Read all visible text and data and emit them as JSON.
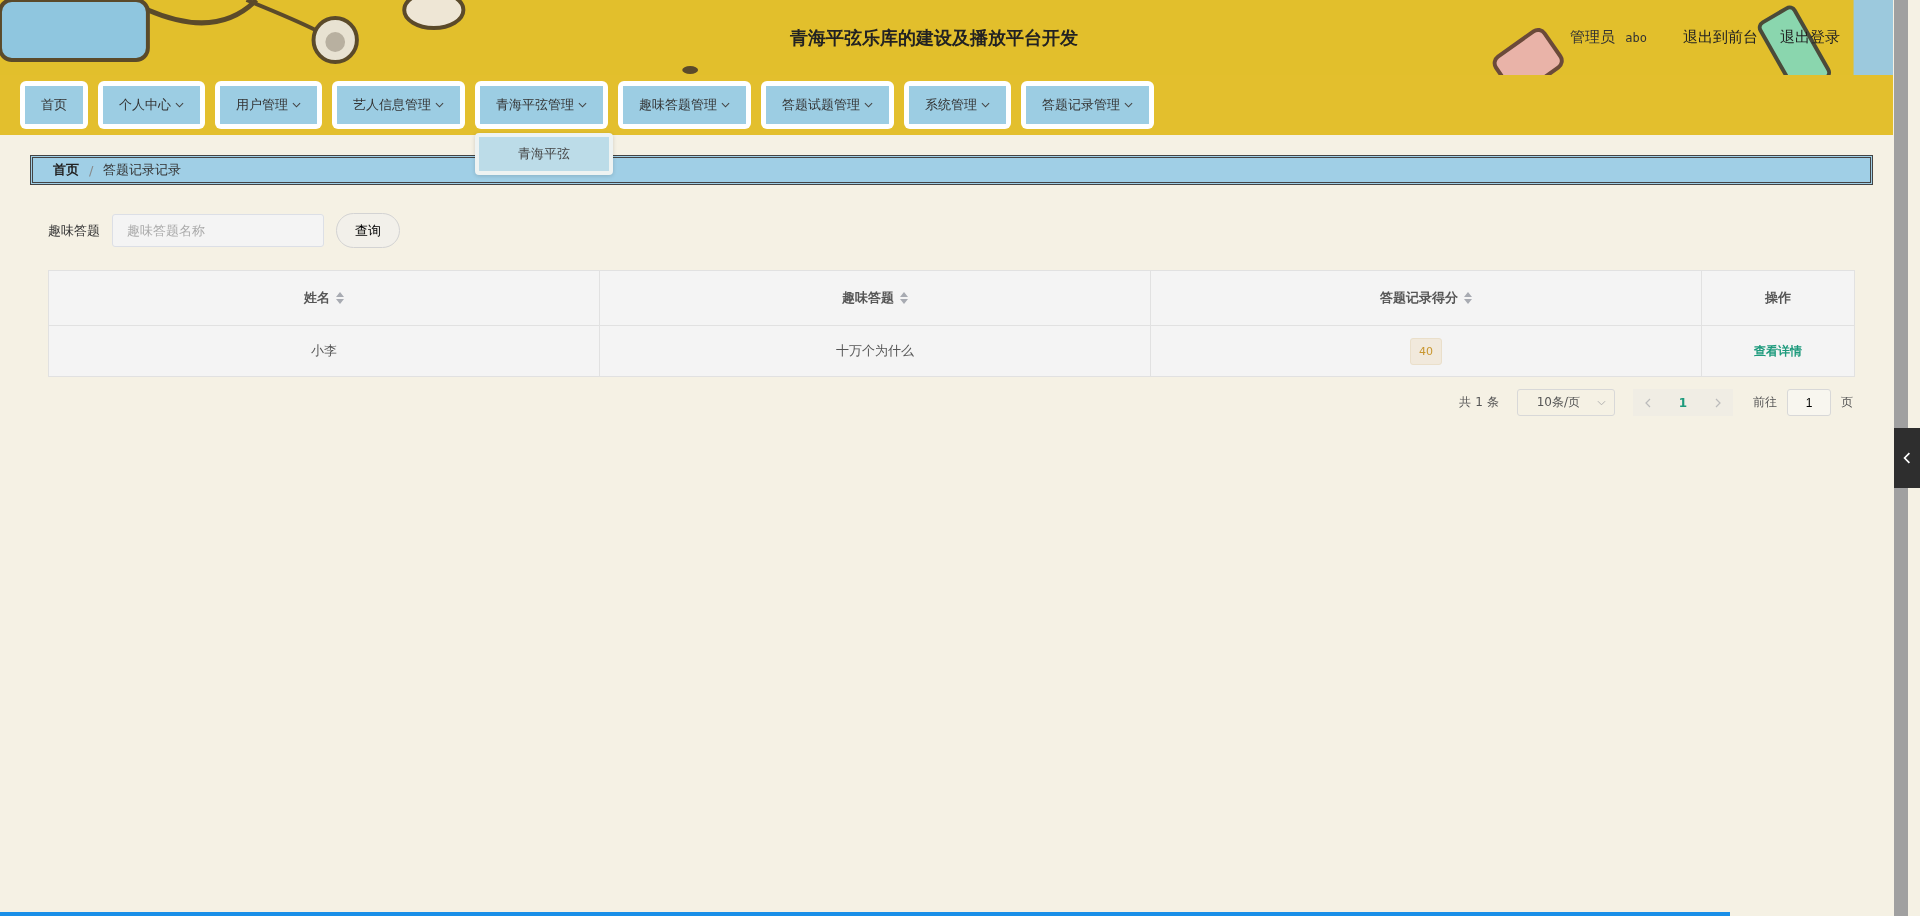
{
  "header": {
    "title": "青海平弦乐库的建设及播放平台开发",
    "role": "管理员",
    "username": "abo",
    "links": [
      "退出到前台",
      "退出登录"
    ]
  },
  "nav": [
    {
      "label": "首页",
      "has_menu": false
    },
    {
      "label": "个人中心",
      "has_menu": true
    },
    {
      "label": "用户管理",
      "has_menu": true
    },
    {
      "label": "艺人信息管理",
      "has_menu": true
    },
    {
      "label": "青海平弦管理",
      "has_menu": true,
      "menu": [
        {
          "label": "青海平弦",
          "hovered": true
        }
      ]
    },
    {
      "label": "趣味答题管理",
      "has_menu": true
    },
    {
      "label": "答题试题管理",
      "has_menu": true
    },
    {
      "label": "系统管理",
      "has_menu": true
    },
    {
      "label": "答题记录管理",
      "has_menu": true
    }
  ],
  "breadcrumb": [
    "首页",
    "答题记录记录"
  ],
  "breadcrumb_separator": "/",
  "search": {
    "label": "趣味答题",
    "placeholder": "趣味答题名称",
    "button": "查询"
  },
  "table": {
    "columns": [
      {
        "label": "姓名",
        "sortable": true
      },
      {
        "label": "趣味答题",
        "sortable": true
      },
      {
        "label": "答题记录得分",
        "sortable": true
      },
      {
        "label": "操作",
        "sortable": false
      }
    ],
    "rows": [
      {
        "cells": [
          {
            "kind": "text",
            "text": "小李"
          },
          {
            "kind": "text",
            "text": "十万个为什么"
          },
          {
            "kind": "tag",
            "text": "40"
          },
          {
            "kind": "link",
            "text": "查看详情"
          }
        ]
      }
    ]
  },
  "pagination": {
    "total_prefix": "共",
    "total": "1",
    "total_suffix": "条",
    "page_size": "10条/页",
    "pages": [
      {
        "label": "1",
        "selected": true
      }
    ],
    "goto_label": "前往",
    "goto_value": "1",
    "goto_suffix": "页"
  }
}
